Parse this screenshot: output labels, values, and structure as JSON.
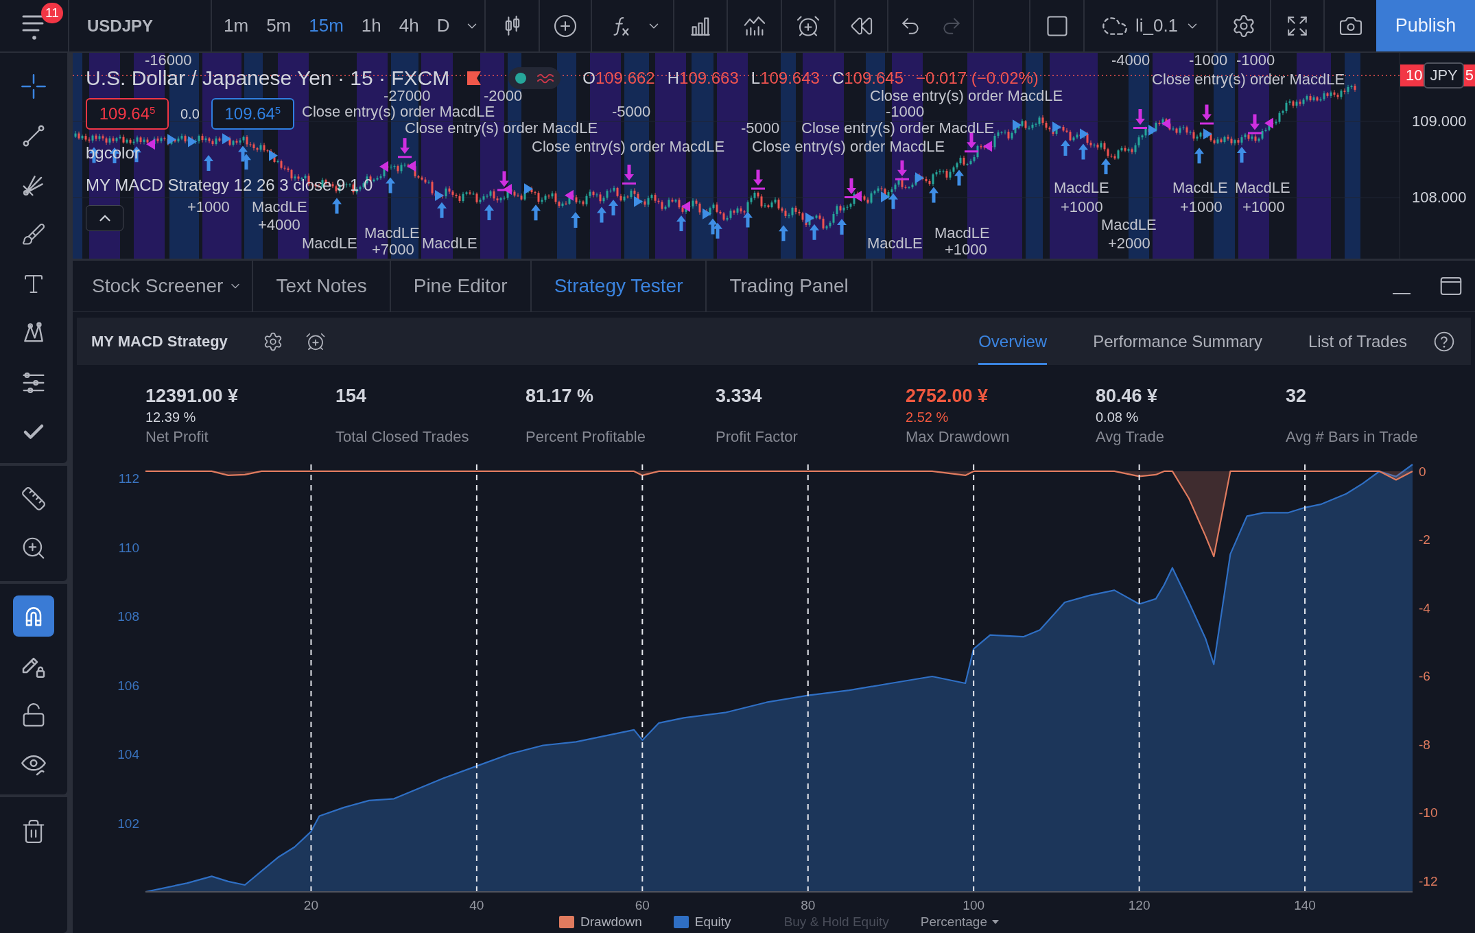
{
  "toolbar": {
    "notification_count": "11",
    "symbol": "USDJPY",
    "intervals": [
      {
        "label": "1m",
        "selected": false
      },
      {
        "label": "5m",
        "selected": false
      },
      {
        "label": "15m",
        "selected": true
      },
      {
        "label": "1h",
        "selected": false
      },
      {
        "label": "4h",
        "selected": false
      },
      {
        "label": "D",
        "selected": false
      }
    ],
    "redo_disabled": true,
    "layout_name": "li_0.1",
    "publish_label": "Publish"
  },
  "drawing_tools": {
    "cursor_selected": true,
    "magnet_on": true
  },
  "chart": {
    "title": "U.S. Dollar / Japanese Yen · 15 · FXCM",
    "ohlc": [
      {
        "key": "O",
        "value": "109.662"
      },
      {
        "key": "H",
        "value": "109.663"
      },
      {
        "key": "L",
        "value": "109.643"
      },
      {
        "key": "C",
        "value": "109.645"
      }
    ],
    "change": "−0.017 (−0.02%)",
    "sell_price": "109.64$^{5}$",
    "spread": "0.0",
    "buy_price": "109.64$^{5}$",
    "indicators": [
      "bgcolor",
      "MY MACD Strategy 12 26 3 close 9 1 0"
    ],
    "annotations": [
      "-16000",
      "-4000",
      "-1000",
      "-1000",
      "Close entry(s) order MacdLE",
      "-27000",
      "-2000",
      "Close entry(s) order MacdLE",
      "Close entry(s) order MacdLE",
      "-5000",
      "-1000",
      "Close entry(s) order MacdLE",
      "-5000",
      "Close entry(s) order MacdLE",
      "Close entry(s) order MacdLE",
      "Close entry(s) order MacdLE",
      "MacdLE",
      "MacdLE",
      "MacdLE",
      "+1000",
      "MacdLE",
      "+1000",
      "+1000",
      "+1000",
      "+4000",
      "MacdLE",
      "MacdLE",
      "MacdLE",
      "MacdLE",
      "MacdLE",
      "MacdLE",
      "+2000",
      "+7000",
      "+1000"
    ],
    "price_scale": [
      "109.000",
      "108.000"
    ],
    "last_price_tag": {
      "lead": "10",
      "tail": "5"
    },
    "currency": "JPY"
  },
  "bottom_panel": {
    "tabs": [
      {
        "label": "Stock Screener",
        "selected": false,
        "has_menu": true
      },
      {
        "label": "Text Notes",
        "selected": false,
        "has_menu": false
      },
      {
        "label": "Pine Editor",
        "selected": false,
        "has_menu": false
      },
      {
        "label": "Strategy Tester",
        "selected": true,
        "has_menu": false
      },
      {
        "label": "Trading Panel",
        "selected": false,
        "has_menu": false
      }
    ],
    "strategy_name": "MY MACD Strategy",
    "report_tabs": [
      {
        "label": "Overview",
        "selected": true
      },
      {
        "label": "Performance Summary",
        "selected": false
      },
      {
        "label": "List of Trades",
        "selected": false
      }
    ],
    "metrics": [
      {
        "value": "12391.00 ¥",
        "sub": "12.39 %",
        "label": "Net Profit",
        "negative": false
      },
      {
        "value": "154",
        "label": "Total Closed Trades",
        "negative": false
      },
      {
        "value": "81.17 %",
        "label": "Percent Profitable",
        "negative": false
      },
      {
        "value": "3.334",
        "label": "Profit Factor",
        "negative": false
      },
      {
        "value": "2752.00 ¥",
        "sub": "2.52 %",
        "label": "Max Drawdown",
        "negative": true
      },
      {
        "value": "80.46 ¥",
        "sub": "0.08 %",
        "label": "Avg Trade",
        "negative": false
      },
      {
        "value": "32",
        "label": "Avg # Bars in Trade",
        "negative": false
      }
    ],
    "chart_data": {
      "type": "area",
      "grid": true,
      "xlim": [
        0,
        153
      ],
      "ylim": [
        100,
        112.4
      ],
      "y2lim": [
        -12.33,
        0.2
      ],
      "xticks": [
        20,
        40,
        60,
        80,
        100,
        120,
        140
      ],
      "yticks": [
        102,
        104,
        106,
        108,
        110,
        112
      ],
      "y2ticks": [
        0,
        -2,
        -4,
        -6,
        -8,
        -10,
        -12
      ],
      "x": [
        0,
        5,
        8,
        10,
        12,
        14,
        16,
        18,
        20,
        21,
        24,
        27,
        30,
        33,
        36,
        40,
        44,
        48,
        52,
        56,
        59,
        60,
        62,
        65,
        70,
        75,
        80,
        85,
        90,
        95,
        99,
        100,
        102,
        106,
        108,
        111,
        114,
        117,
        120,
        122,
        123,
        124,
        126,
        128,
        129,
        131,
        133,
        135,
        138,
        140,
        142,
        145,
        147,
        149,
        151,
        153
      ],
      "series": [
        {
          "name": "Drawdown",
          "color": "#e07b5f",
          "axis": "y2",
          "values": [
            0,
            0,
            0,
            -0.12,
            -0.1,
            0,
            0,
            0,
            0,
            0,
            0,
            0,
            0,
            0,
            0,
            0,
            0,
            0,
            0,
            0,
            0,
            -0.12,
            0,
            0,
            0,
            0,
            0,
            0,
            0,
            0,
            -0.12,
            0,
            0,
            0,
            0,
            0,
            0,
            0,
            -0.15,
            -0.1,
            0,
            0,
            -0.8,
            -1.9,
            -2.5,
            0,
            0,
            0,
            0,
            0,
            0,
            0,
            0,
            0,
            -0.25,
            0
          ]
        },
        {
          "name": "Equity",
          "color": "#2f6fc4",
          "values": [
            100.0,
            100.25,
            100.45,
            100.3,
            100.2,
            100.6,
            101.0,
            101.3,
            101.75,
            102.2,
            102.45,
            102.65,
            102.7,
            103.0,
            103.3,
            103.65,
            104.0,
            104.25,
            104.35,
            104.55,
            104.7,
            104.4,
            104.9,
            105.05,
            105.2,
            105.5,
            105.7,
            105.85,
            106.05,
            106.25,
            106.05,
            107.05,
            107.45,
            107.4,
            107.6,
            108.4,
            108.6,
            108.75,
            108.35,
            108.5,
            108.9,
            109.4,
            108.4,
            107.35,
            106.6,
            109.8,
            110.9,
            111.0,
            111.0,
            111.15,
            111.25,
            111.55,
            111.85,
            112.2,
            112.05,
            112.4
          ]
        }
      ]
    },
    "legend": [
      {
        "enabled": true
      },
      {
        "enabled": true
      },
      {
        "label": "Buy & Hold Equity",
        "enabled": false
      }
    ],
    "scale_mode": "Percentage"
  }
}
